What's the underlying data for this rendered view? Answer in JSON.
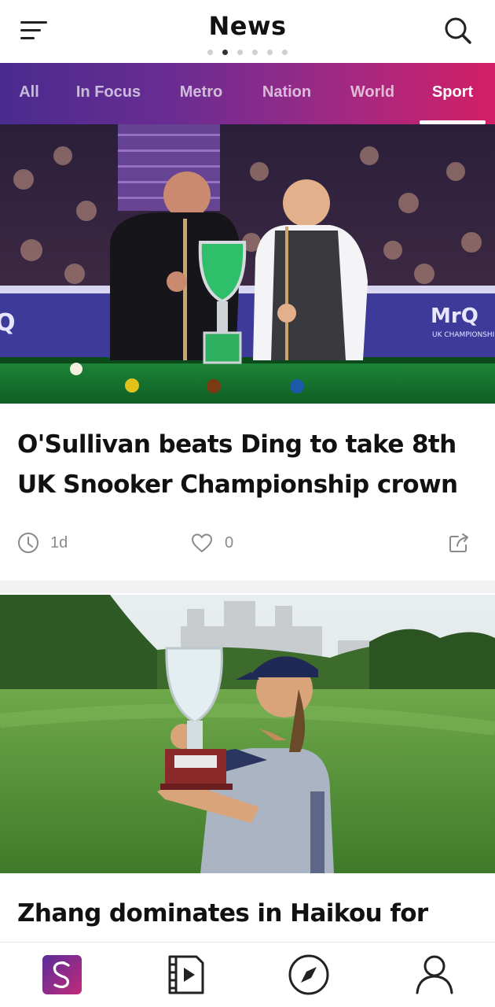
{
  "header": {
    "title": "News",
    "page_indicator": {
      "count": 6,
      "active_index": 1
    },
    "menu_icon": "menu-icon",
    "search_icon": "search-icon"
  },
  "tabs": [
    {
      "label": "All"
    },
    {
      "label": "In Focus"
    },
    {
      "label": "Metro"
    },
    {
      "label": "Nation"
    },
    {
      "label": "World"
    },
    {
      "label": "Sport",
      "active": true
    }
  ],
  "articles": [
    {
      "image": "snooker-players-with-trophy-photo",
      "image_text": "MrQ",
      "image_subtext": "UK CHAMPIONSHIP",
      "headline": "O'Sullivan beats Ding to take 8th UK Snooker Championship crown",
      "time": "1d",
      "likes": "0",
      "icons": [
        "clock-icon",
        "heart-icon",
        "share-icon"
      ]
    },
    {
      "image": "golfer-with-trophy-photo",
      "headline": "Zhang dominates in Haikou for"
    }
  ],
  "bottom_nav": [
    {
      "icon": "app-logo-icon",
      "active": true
    },
    {
      "icon": "video-icon"
    },
    {
      "icon": "compass-icon"
    },
    {
      "icon": "profile-icon"
    }
  ],
  "colors": {
    "tab_gradient_start": "#4a2b8f",
    "tab_gradient_end": "#d41f66",
    "brand_logo": "#8e2f9e"
  }
}
